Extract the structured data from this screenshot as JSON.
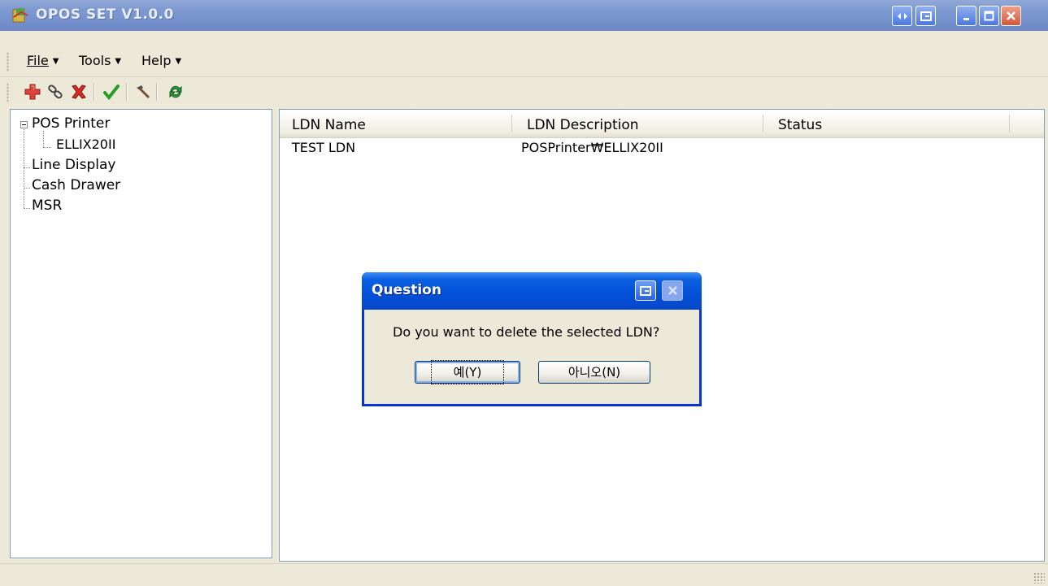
{
  "window": {
    "title": "OPOS SET V1.0.0"
  },
  "menu": [
    {
      "label": "File"
    },
    {
      "label": "Tools"
    },
    {
      "label": "Help"
    }
  ],
  "toolbar": {
    "icons": [
      "add-icon",
      "link-icon",
      "delete-icon",
      "check-icon",
      "hammer-icon",
      "refresh-icon"
    ]
  },
  "tree": {
    "items": [
      {
        "label": "POS Printer"
      },
      {
        "label": "ELLIX20II"
      },
      {
        "label": "Line Display"
      },
      {
        "label": "Cash Drawer"
      },
      {
        "label": "MSR"
      }
    ]
  },
  "list": {
    "columns": [
      "LDN Name",
      "LDN Description",
      "Status"
    ],
    "rows": [
      {
        "name": "TEST LDN",
        "description": "POSPrinter₩ELLIX20II",
        "status": ""
      }
    ]
  },
  "dialog": {
    "title": "Question",
    "message": "Do you want to delete the selected LDN?",
    "yes_label": "예(Y)",
    "no_label": "아니오(N)"
  },
  "colors": {
    "titlebar": "#7e9ad1",
    "dialog_titlebar": "#0350d8",
    "window_bg": "#ece9d8"
  }
}
